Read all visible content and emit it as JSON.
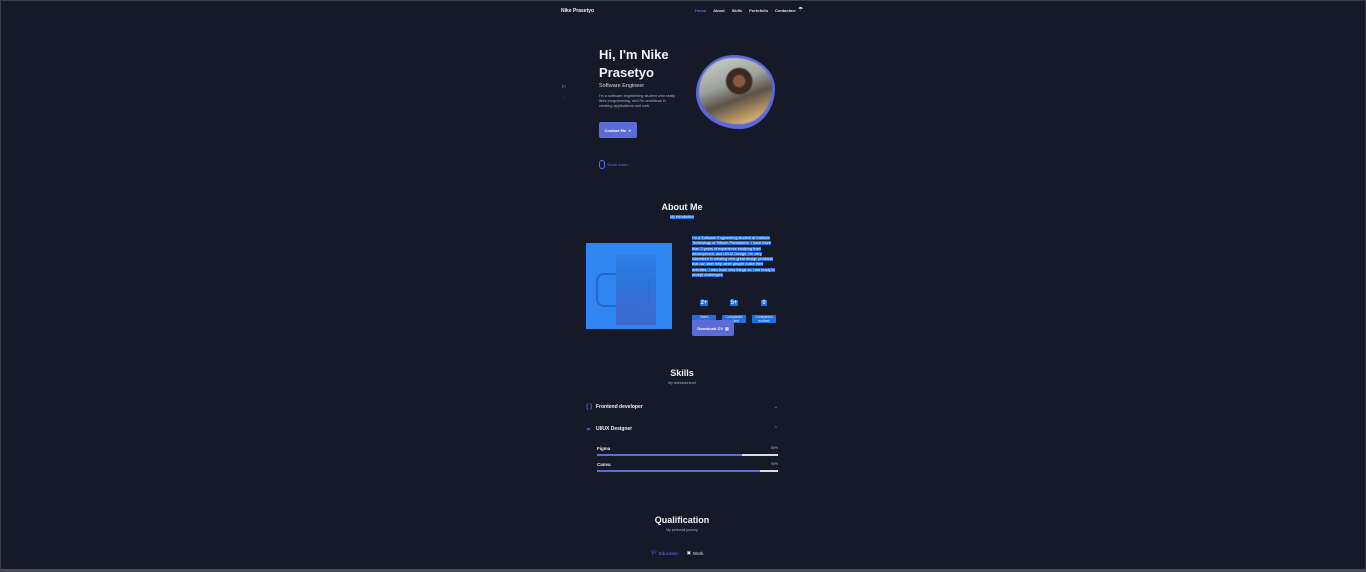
{
  "nav": {
    "brand": "Nike Prasetyo",
    "items": [
      "Home",
      "About",
      "Skills",
      "Portofolio",
      "Contactme"
    ],
    "active": 0
  },
  "hero": {
    "title": "Hi, I'm Nike Prasetyo",
    "subtitle": "Software Engineer",
    "description": "I'm a software engineering student who really likes programming, and I'm ambitious in creating applications and web.",
    "contact_label": "Contact Me",
    "scroll_label": "Scroll down"
  },
  "about": {
    "title": "About Me",
    "subtitle": "My introduction",
    "text": "I'm a Software Engineering student at Institute Technology of Telkom Purwokerto. I have more than 2 years of experience studying front development, and UI/UX Design. I'm very interested in creating new great design products that can later help other people make their activities. I also learn new things so I am ready to accept challenges.",
    "stats": [
      {
        "number": "2+",
        "label": "Years experience"
      },
      {
        "number": "5+",
        "label": "Completed project"
      },
      {
        "number": "0",
        "label": "Companies worked"
      }
    ],
    "cv_label": "Download CV"
  },
  "skills": {
    "title": "Skills",
    "subtitle": "My technical level",
    "groups": [
      {
        "name": "Frontend developer",
        "expanded": false
      },
      {
        "name": "UI/UX Designer",
        "expanded": true
      }
    ],
    "bars": [
      {
        "name": "Figma",
        "percent": "80%",
        "value": 0.8
      },
      {
        "name": "Canva",
        "percent": "90%",
        "value": 0.9
      }
    ]
  },
  "qualification": {
    "title": "Qualification",
    "subtitle": "My personal journey",
    "tabs": [
      "Education",
      "Work"
    ],
    "active_tab": 0
  },
  "colors": {
    "background": "#161a28",
    "accent": "#5b6cd8",
    "highlight": "#1e6fe0"
  }
}
